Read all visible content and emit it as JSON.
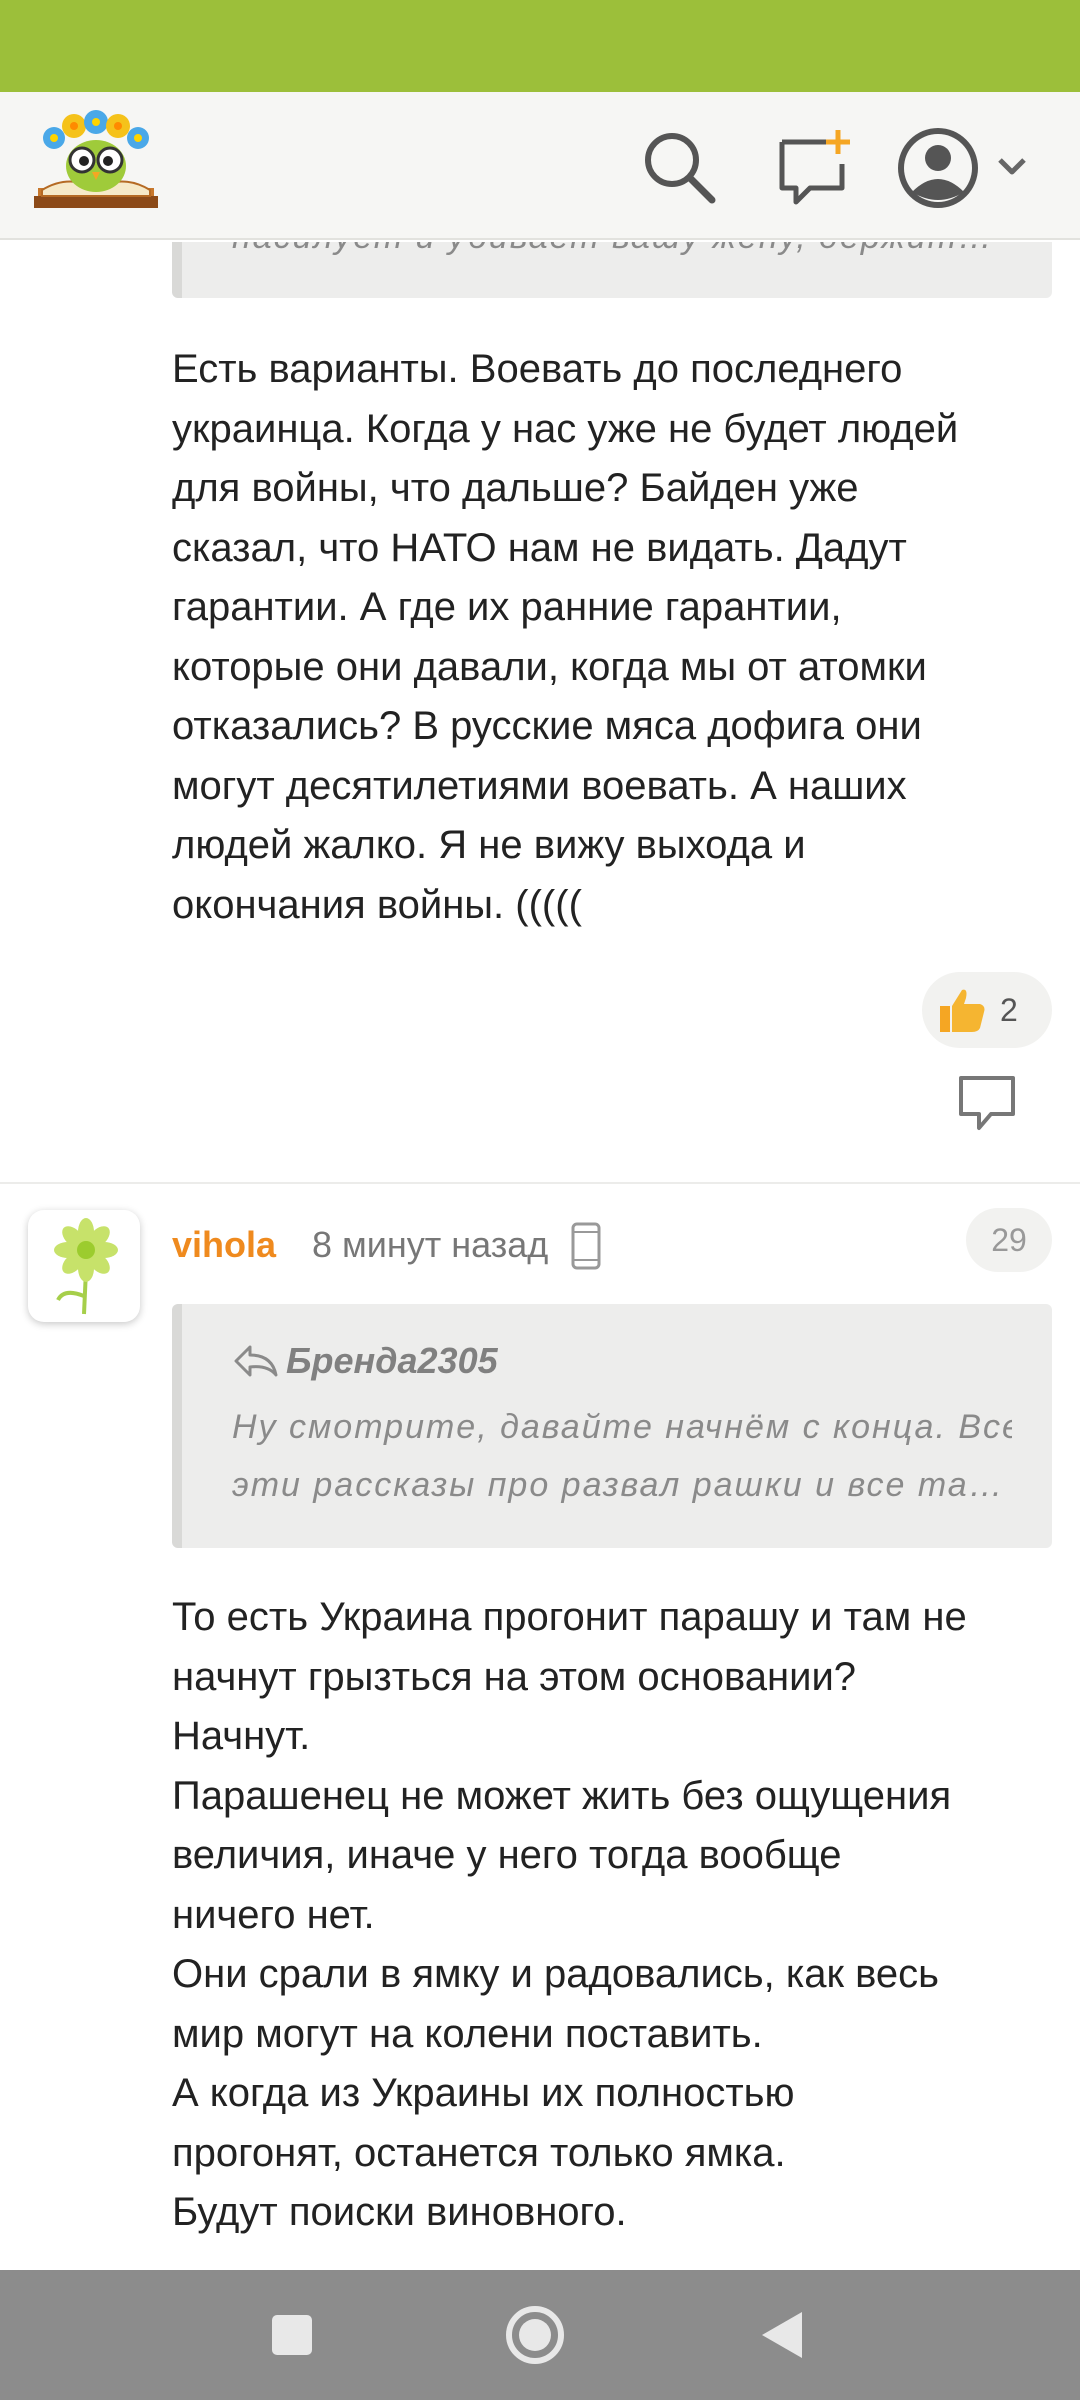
{
  "colors": {
    "status_bar": "#9cbf3a",
    "username": "#ef8a1e",
    "accent_orange": "#f5a623"
  },
  "header": {
    "logo_icon": "owl-book-logo",
    "search_icon": "search-icon",
    "new_message_icon": "chat-plus-icon",
    "profile_icon": "user-avatar-icon"
  },
  "thread": {
    "prev_comment": {
      "quote_text_partial": "насилует и убивает вашу жену, держит…",
      "text": "Есть варианты. Воевать до последнего\nукраинца. Когда у нас уже не будет людей\nдля войны, что дальше? Байден уже\nсказал, что НАТО нам не видать. Дадут\nгарантии. А где их ранние гарантии,\nкоторые они давали, когда мы от атомки\nотказались? В русские мяса дофига они\nмогут десятилетиями воевать. А наших\nлюдей жалко. Я не вижу выхода и\nокончания войны. (((((",
      "like_count": "2"
    },
    "comment": {
      "username": "vihola",
      "time": "8 минут назад",
      "device_icon": "mobile-phone-icon",
      "number": "29",
      "quote_author": "Бренда2305",
      "quote_line1": "Ну смотрите, давайте начнём с конца. Все",
      "quote_line2": "эти рассказы про развал рашки и все тако…",
      "text": "То есть Украина прогонит парашу и там не\nначнут грызться на этом основании?\nНачнут.\nПарашенец не может жить без ощущения\nвеличия, иначе у него тогда вообще\nничего нет.\nОни срали в ямку и радовались, как весь\nмир могут на колени поставить.\nА когда из Украины их полностью\nпрогонят, останется только ямка.\nБудут поиски виновного."
    }
  },
  "navbar": {
    "recents_icon": "square-icon",
    "home_icon": "circle-icon",
    "back_icon": "triangle-back-icon"
  }
}
